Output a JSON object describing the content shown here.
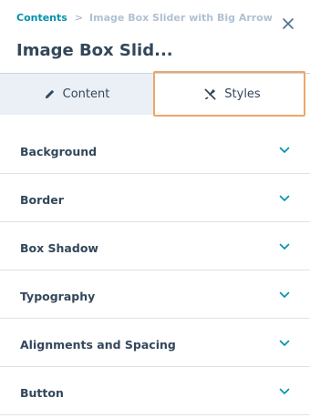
{
  "breadcrumb": {
    "parent": "Contents",
    "separator": ">",
    "current": "Image Box Slider with Big Arrow"
  },
  "page_title": "Image Box Slid...",
  "tabs": [
    {
      "label": "Content",
      "icon": "pencil-icon",
      "active": false
    },
    {
      "label": "Styles",
      "icon": "styles-icon",
      "active": true
    }
  ],
  "sections": [
    {
      "label": "Background"
    },
    {
      "label": "Border"
    },
    {
      "label": "Box Shadow"
    },
    {
      "label": "Typography"
    },
    {
      "label": "Alignments and Spacing"
    },
    {
      "label": "Button"
    }
  ],
  "colors": {
    "link": "#0091ae",
    "text": "#33475b",
    "highlight": "#eea667",
    "divider": "#dfe3eb"
  }
}
